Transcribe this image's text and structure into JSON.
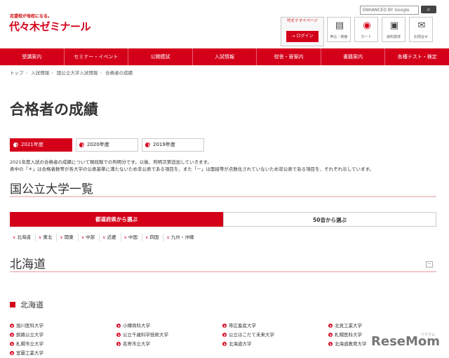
{
  "header": {
    "tagline": "志望校が母校になる。",
    "logo": "代々木ゼミナール",
    "search_placeholder": "ENHANCED BY Google",
    "search_icon": "magnifier-icon",
    "mypage_title": "代ゼミマイページ",
    "login_label": "ログイン",
    "utility": [
      {
        "label": "申込・検索",
        "icon": "form-icon"
      },
      {
        "label": "カート",
        "icon": "cart-icon",
        "badge": "0"
      },
      {
        "label": "資料請求",
        "icon": "brochure-icon"
      },
      {
        "label": "お問合せ",
        "icon": "mail-icon"
      }
    ]
  },
  "nav": [
    "受講案内",
    "セミナー・イベント",
    "公開模試",
    "入試情報",
    "校舎・寮案内",
    "書籍案内",
    "各種テスト・検定"
  ],
  "breadcrumb": [
    "トップ",
    "入試情報",
    "国公立大学入試情報",
    "合格者の成績"
  ],
  "page_title": "合格者の成績",
  "year_tabs": [
    {
      "label": "2021年度",
      "active": true
    },
    {
      "label": "2020年度",
      "active": false
    },
    {
      "label": "2019年度",
      "active": false
    }
  ],
  "notes": [
    "2021年度入試の合格者の成績について現段階での判明分です。以後、判明次第追加していきます。",
    "表中の「＊」は合格者数等が各大学の公表基準に満たないため非公表である項目を、また「－」は面接等が点数化されていないため非公表である項目を、それぞれ示しています。"
  ],
  "section_heading": "国公立大学一覧",
  "select_tabs": {
    "active": "都道府県から選ぶ",
    "inactive": "50音から選ぶ"
  },
  "regions": [
    "北海道",
    "東北",
    "関東",
    "中部",
    "近畿",
    "中国",
    "四国",
    "九州・沖縄"
  ],
  "area_heading": "北海道",
  "collapse_label": "－",
  "pref_heading": "北海道",
  "universities": [
    [
      "旭川医科大学",
      "小樽商科大学",
      "帯広畜産大学",
      "北見工業大学"
    ],
    [
      "釧路公立大学",
      "公立千歳科学技術大学",
      "公立はこだて未来大学",
      "札幌医科大学"
    ],
    [
      "札幌市立大学",
      "名寄市立大学",
      "北海道大学",
      "北海道教育大学"
    ],
    [
      "室蘭工業大学"
    ]
  ],
  "watermark": "ReseMom",
  "watermark_sub": "リセマム"
}
